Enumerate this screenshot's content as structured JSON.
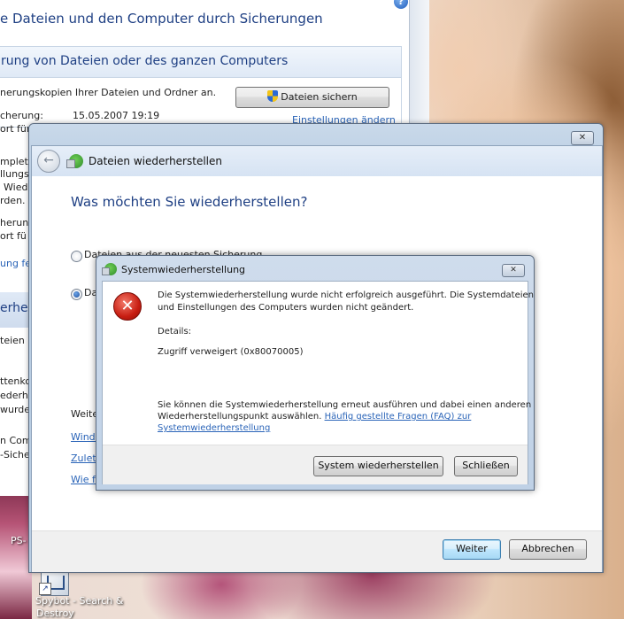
{
  "desktop": {
    "icon_label_line1": "PS-",
    "spybot_label_line1": "Spybot - Search &",
    "spybot_label_line2": "Destroy"
  },
  "background_window": {
    "title": "e Dateien und den Computer durch Sicherungen",
    "help": "?",
    "panel_title": "rung von Dateien oder des ganzen Computers",
    "line1": "nerungskopien Ihrer Dateien und Ordner an.",
    "backup_button": "Dateien sichern",
    "last_backup_label": "cherung:",
    "last_backup_value": "15.05.2007 19:19",
    "settings_link": "Einstellungen ändern",
    "frag1": "ort für",
    "frag2": "mplet",
    "frag3": "llungs",
    "frag4": "Wied",
    "frag5": "rden.",
    "frag6": "herun",
    "frag7": "ort fü",
    "frag8": "ung fe",
    "section_label": "erher",
    "frag9": "teien (",
    "frag10": "ttenko",
    "frag11": "ederhe",
    "frag12": "wurde",
    "frag13": "n Com",
    "frag14": "-Siche"
  },
  "wizard": {
    "close_label": "✕",
    "back_arrow": "←",
    "title": "Dateien wiederherstellen",
    "question": "Was möchten Sie wiederherstellen?",
    "option1_label": "Dateien aus der neuesten Sicherung",
    "option2_label_fragment": "Da",
    "more_label": "Weite",
    "link1": "Windo",
    "link2": "Zuletz",
    "link3": "Wie fu",
    "next_button": "Weiter",
    "cancel_button": "Abbrechen"
  },
  "error_dialog": {
    "title": "Systemwiederherstellung",
    "close_label": "✕",
    "error_glyph": "✕",
    "message_line1": "Die Systemwiederherstellung wurde nicht erfolgreich ausgeführt. Die Systemdateien",
    "message_line2": "und Einstellungen des Computers wurden nicht geändert.",
    "details_label": "Details:",
    "details_value": "Zugriff verweigert (0x80070005)",
    "info_line1": "Sie können die Systemwiederherstellung erneut ausführen und dabei einen anderen",
    "info_line2_prefix": "Wiederherstellungspunkt auswählen.",
    "faq_link_line1": "Häufig gestellte Fragen (FAQ) zur",
    "faq_link_line2": "Systemwiederherstellung",
    "restore_button": "System wiederherstellen",
    "close_button": "Schließen"
  }
}
